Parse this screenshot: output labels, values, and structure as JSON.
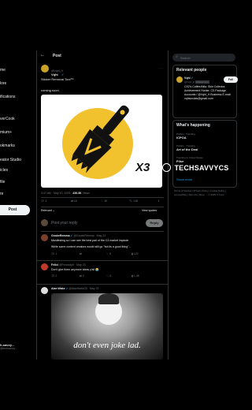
{
  "sidebar": {
    "items": [
      "me",
      "lore",
      "ifications",
      "verCook",
      "mium+",
      "okmarks",
      "eator Studio",
      "icles",
      "file",
      "re"
    ],
    "post_button": "Post",
    "account_name": "h-savvy...",
    "account_handle": "@techsavvy..."
  },
  "main": {
    "back_icon": "arrow-left-icon",
    "header_title": "Post",
    "post": {
      "author": "Vqhi",
      "handle": "@Vqhi_H",
      "text1": "Sticker Removal Tool™",
      "text2": "coming soon.",
      "badge": "X3",
      "timestamp": "4:47 AM · May 20, 2025 ·",
      "views_count": "436.3K",
      "views_label": "Views",
      "stats": {
        "replies": "4",
        "reposts": "16",
        "likes": "1K",
        "bookmarks": "118"
      },
      "related_label": "Relevant",
      "quotes_label": "View quotes"
    },
    "reply_box": {
      "placeholder": "Post your reply",
      "button": "Reply"
    },
    "replies": [
      {
        "name": "GoukeRemma",
        "handle": "@GoukeRemma · May 23",
        "text1": "Manifesting so I can see the best part of the C3 market implode",
        "text2": "While some content creators would still go \"but its a good thing\"...",
        "stats": [
          "1",
          "",
          "5",
          "122"
        ]
      },
      {
        "name": "Felici",
        "handle": "@Fercdolph · May 23",
        "text1": "Don't give them anymore ideas y'all 😭",
        "stats": [
          "2",
          "2",
          "3",
          "1.3K"
        ]
      },
      {
        "name": "Alan Wake",
        "handle": "@AlanWake23 · May 23",
        "caption": "don't even joke lad."
      }
    ]
  },
  "right": {
    "search_placeholder": "Search",
    "relevant_title": "Relevant people",
    "person_name": "Vqhi",
    "person_handle": "@Vqhi_H",
    "person_tag": "Follows you",
    "follow_label": "Foll",
    "person_bio": "CS2's Coffee/Ailia. Skin Collector, Achievement Hunter, CS Package Accounts / @Vqhi_H Business E-mail: vqhisocials@gmail.com",
    "happening_title": "What's happening",
    "trends": [
      {
        "meta": "Politics · Trending",
        "name": "ICPOA"
      },
      {
        "meta": "Politics · Trending",
        "name": "Art of the Deal"
      },
      {
        "meta": "Trending in United States",
        "name": "Pilse"
      }
    ],
    "show_more": "Show more",
    "footer": "Terms of Service | Privacy Policy | Cookie Policy | Accessibility | Ads info | More ··· © 2025 X Corp."
  },
  "watermark": "TECHSAVVYCS",
  "colors": {
    "accent": "#1d9bf0",
    "yellow": "#f2c12e",
    "dark": "#000000",
    "border": "#2f3336"
  }
}
